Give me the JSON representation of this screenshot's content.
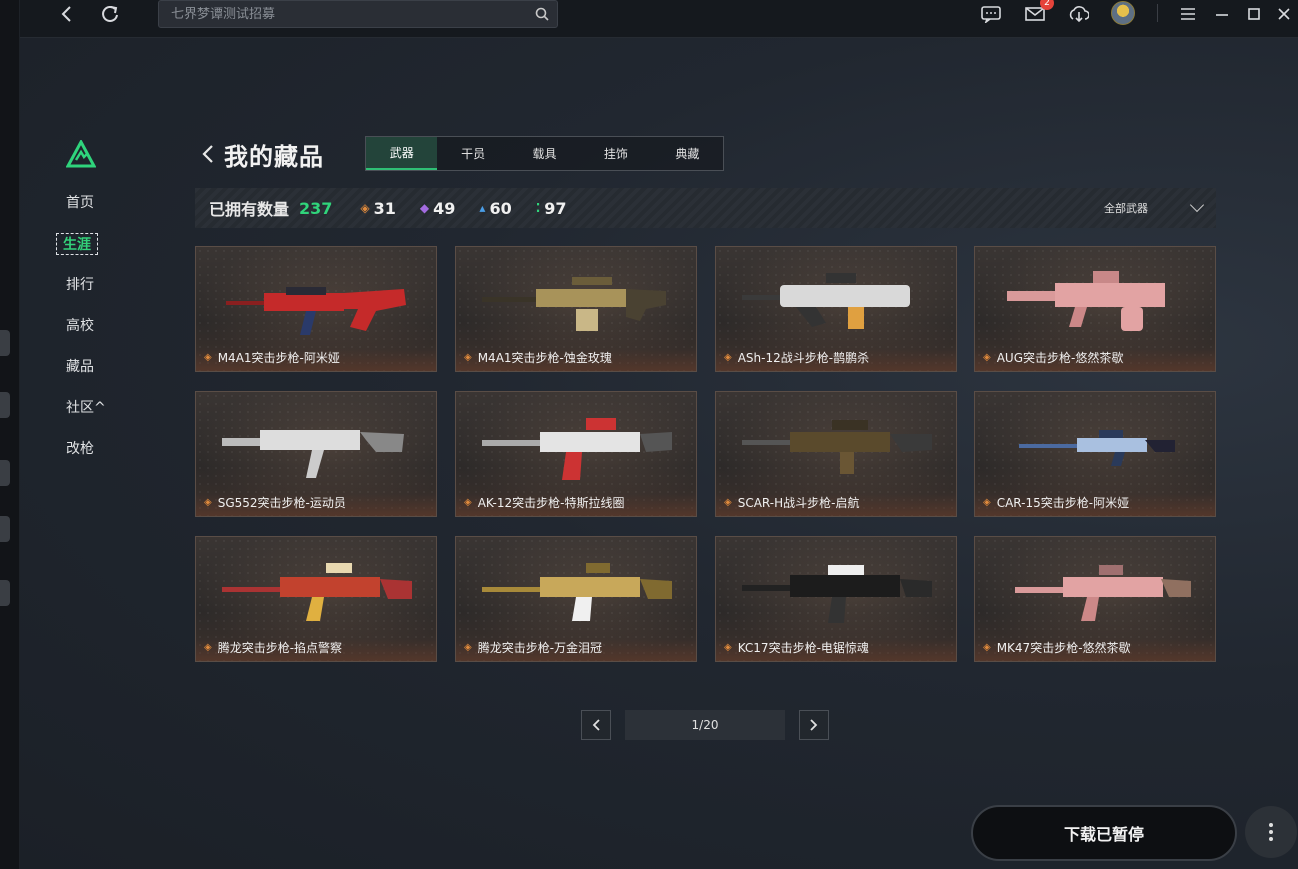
{
  "topbar": {
    "search_placeholder": "七界梦谭测试招募",
    "mail_badge": "2"
  },
  "sidebar": {
    "items": [
      {
        "label": "首页"
      },
      {
        "label": "生涯"
      },
      {
        "label": "排行"
      },
      {
        "label": "高校"
      },
      {
        "label": "藏品"
      },
      {
        "label": "社区^"
      },
      {
        "label": "改枪"
      }
    ]
  },
  "page": {
    "title": "我的藏品",
    "tabs": [
      {
        "label": "武器"
      },
      {
        "label": "干员"
      },
      {
        "label": "载具"
      },
      {
        "label": "挂饰"
      },
      {
        "label": "典藏"
      }
    ]
  },
  "stats": {
    "owned_label": "已拥有数量",
    "owned_count": "237",
    "orange": "31",
    "purple": "49",
    "blue": "60",
    "green": "97",
    "filter_label": "全部武器",
    "colors": {
      "orange": "#e08a3c",
      "purple": "#a36be0",
      "blue": "#4a9ee8",
      "green": "#30d47b"
    }
  },
  "items": [
    {
      "name": "M4A1突击步枪-阿米娅"
    },
    {
      "name": "M4A1突击步枪-蚀金玫瑰"
    },
    {
      "name": "ASh-12战斗步枪-鹊鹏杀"
    },
    {
      "name": "AUG突击步枪-悠然茶歇"
    },
    {
      "name": "SG552突击步枪-运动员"
    },
    {
      "name": "AK-12突击步枪-特斯拉线圈"
    },
    {
      "name": "SCAR-H战斗步枪-启航"
    },
    {
      "name": "CAR-15突击步枪-阿米娅"
    },
    {
      "name": "腾龙突击步枪-掐点警察"
    },
    {
      "name": "腾龙突击步枪-万金泪冠"
    },
    {
      "name": "KC17突击步枪-电锯惊魂"
    },
    {
      "name": "MK47突击步枪-悠然茶歇"
    }
  ],
  "pagination": {
    "current": "1/20"
  },
  "download": {
    "label": "下载已暂停"
  },
  "accent_color": "#30d47b"
}
